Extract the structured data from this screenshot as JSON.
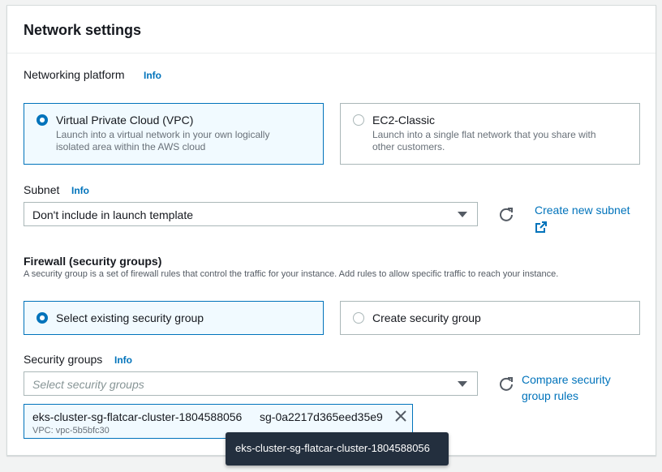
{
  "section": {
    "title": "Network settings"
  },
  "networking_platform": {
    "label": "Networking platform",
    "info": "Info",
    "options": [
      {
        "title": "Virtual Private Cloud (VPC)",
        "desc_line1": "Launch into a virtual network in your own logically",
        "desc_line2": "isolated area within the AWS cloud",
        "selected": true
      },
      {
        "title": "EC2-Classic",
        "desc_line1": "Launch into a single flat network that you share with",
        "desc_line2": "other customers.",
        "selected": false
      }
    ]
  },
  "subnet": {
    "label": "Subnet",
    "info": "Info",
    "value": "Don't include in launch template",
    "create_link": "Create new subnet"
  },
  "firewall": {
    "title": "Firewall (security groups)",
    "description": "A security group is a set of firewall rules that control the traffic for your instance. Add rules to allow specific traffic to reach your instance.",
    "options": [
      {
        "title": "Select existing security group",
        "selected": true
      },
      {
        "title": "Create security group",
        "selected": false
      }
    ]
  },
  "security_groups": {
    "label": "Security groups",
    "info": "Info",
    "placeholder": "Select security groups",
    "compare_link_line1": "Compare security",
    "compare_link_line2": "group rules",
    "selected_token": {
      "name": "eks-cluster-sg-flatcar-cluster-1804588056",
      "id": "sg-0a2217d365eed35e9",
      "vpc": "VPC: vpc-5b5bfc30"
    }
  },
  "tooltip": {
    "text": "eks-cluster-sg-flatcar-cluster-1804588056"
  },
  "colors": {
    "accent": "#0073bb",
    "selected_bg": "#f1faff",
    "tooltip_bg": "#232f3e"
  }
}
